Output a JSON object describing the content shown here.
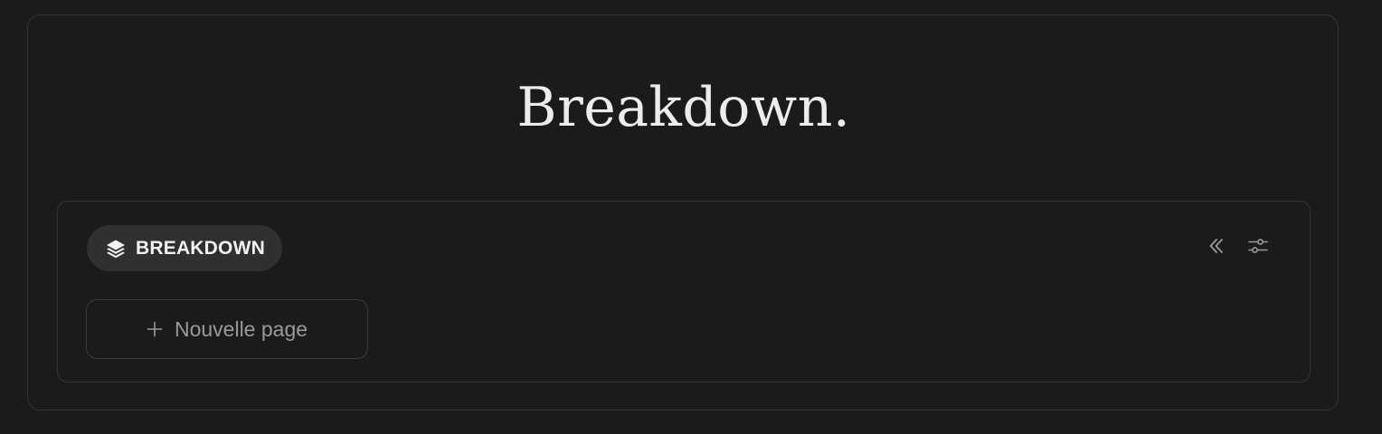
{
  "header": {
    "title": "Breakdown."
  },
  "section": {
    "tag_label": "BREAKDOWN",
    "tag_icon": "layers-icon",
    "toolbar": {
      "collapse_icon": "chevrons-left-icon",
      "settings_icon": "sliders-icon"
    },
    "new_page_label": "Nouvelle page",
    "new_page_icon": "plus-icon"
  },
  "colors": {
    "background": "#1b1b1b",
    "border": "#333333",
    "title": "#ececec",
    "pill": "#303030",
    "muted": "#9a9a9a"
  }
}
